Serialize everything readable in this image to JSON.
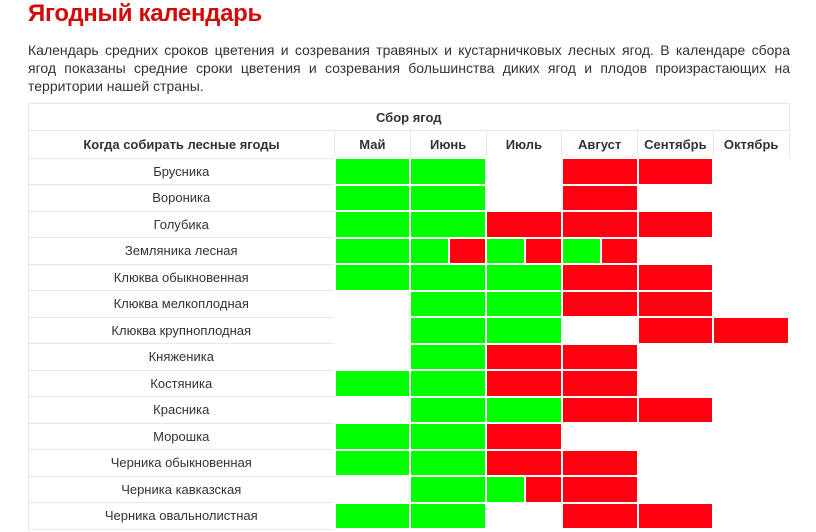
{
  "title": "Ягодный календарь",
  "intro": "Календарь средних сроков цветения и созревания травяных и кустарничковых лесных ягод. В календаре сбора ягод показаны средние сроки цветения и созревания большинства диких ягод и плодов произрастающих на территории нашей страны.",
  "table": {
    "caption": "Сбор ягод",
    "first_header": "Когда собирать лесные ягоды",
    "months": [
      "Май",
      "Июнь",
      "Июль",
      "Август",
      "Сентябрь",
      "Октябрь"
    ],
    "legend_colors": {
      "g": "#00ff00",
      "r": "#ff0010",
      "w": "#ffffff",
      "gr": "green then red"
    },
    "rows": [
      {
        "name": "Брусника",
        "cells": [
          "g",
          "g",
          "w",
          "r",
          "r",
          "w"
        ]
      },
      {
        "name": "Вороника",
        "cells": [
          "g",
          "g",
          "w",
          "r",
          "w",
          "w"
        ]
      },
      {
        "name": "Голубика",
        "cells": [
          "g",
          "g",
          "r",
          "r",
          "r",
          "w"
        ]
      },
      {
        "name": "Земляника лесная",
        "cells": [
          "g",
          "gr",
          "gr",
          "gr",
          "w",
          "w"
        ]
      },
      {
        "name": "Клюква обыкновенная",
        "cells": [
          "g",
          "g",
          "g",
          "r",
          "r",
          "w"
        ]
      },
      {
        "name": "Клюква мелкоплодная",
        "cells": [
          "w",
          "g",
          "g",
          "r",
          "r",
          "w"
        ]
      },
      {
        "name": "Клюква крупноплодная",
        "cells": [
          "w",
          "g",
          "g",
          "w",
          "r",
          "r"
        ]
      },
      {
        "name": "Княженика",
        "cells": [
          "w",
          "g",
          "r",
          "r",
          "w",
          "w"
        ]
      },
      {
        "name": "Костяника",
        "cells": [
          "g",
          "g",
          "r",
          "r",
          "w",
          "w"
        ]
      },
      {
        "name": "Красника",
        "cells": [
          "w",
          "g",
          "g",
          "r",
          "r",
          "w"
        ]
      },
      {
        "name": "Морошка",
        "cells": [
          "g",
          "g",
          "r",
          "w",
          "w",
          "w"
        ]
      },
      {
        "name": "Черника обыкновенная",
        "cells": [
          "g",
          "g",
          "r",
          "r",
          "w",
          "w"
        ]
      },
      {
        "name": "Черника кавказская",
        "cells": [
          "w",
          "g",
          "gr",
          "r",
          "w",
          "w"
        ]
      },
      {
        "name": "Черника овальнолистная",
        "cells": [
          "g",
          "g",
          "w",
          "r",
          "r",
          "w"
        ]
      }
    ]
  }
}
